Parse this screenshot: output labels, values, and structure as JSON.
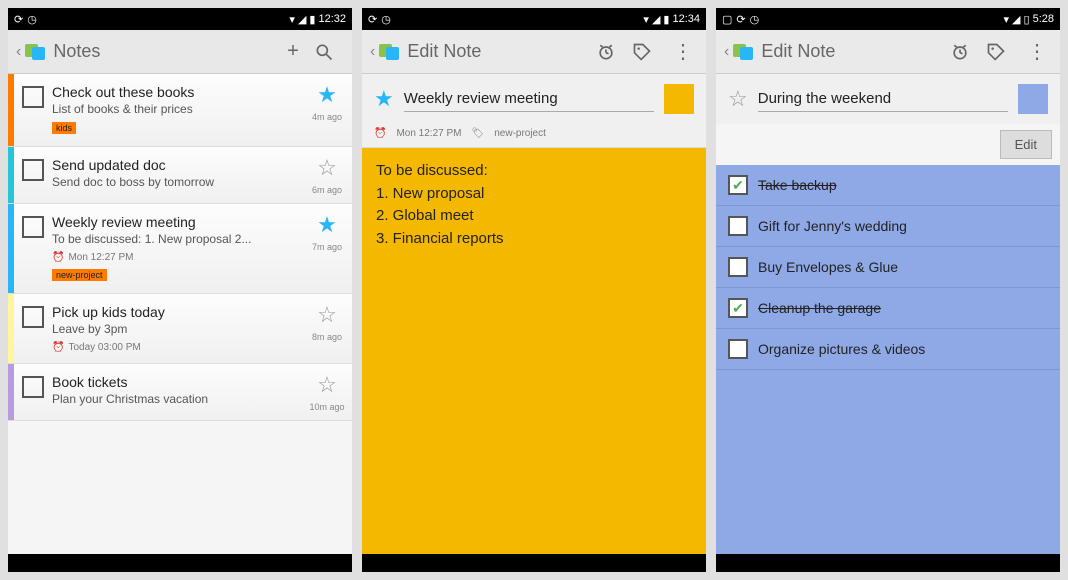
{
  "screen1": {
    "status_time": "12:32",
    "title": "Notes",
    "notes": [
      {
        "stripe": "#ff7b00",
        "title": "Check out these books",
        "sub": "List of books & their prices",
        "tag": "kids",
        "starred": true,
        "ago": "4m ago",
        "reminder": ""
      },
      {
        "stripe": "#26c6da",
        "title": "Send updated doc",
        "sub": "Send doc to boss by tomorrow",
        "tag": "",
        "starred": false,
        "ago": "6m ago",
        "reminder": ""
      },
      {
        "stripe": "#29b6f6",
        "title": "Weekly review meeting",
        "sub": "To be discussed: 1. New proposal 2...",
        "tag": "new-project",
        "starred": true,
        "ago": "7m ago",
        "reminder": "Mon 12:27 PM"
      },
      {
        "stripe": "#fff59d",
        "title": "Pick up kids today",
        "sub": "Leave by 3pm",
        "tag": "",
        "starred": false,
        "ago": "8m ago",
        "reminder": "Today 03:00 PM"
      },
      {
        "stripe": "#b39ddb",
        "title": "Book tickets",
        "sub": "Plan your Christmas vacation",
        "tag": "",
        "starred": false,
        "ago": "10m ago",
        "reminder": ""
      }
    ]
  },
  "screen2": {
    "status_time": "12:34",
    "title": "Edit Note",
    "note_title": "Weekly review meeting",
    "swatch": "#f5b800",
    "reminder": "Mon 12:27 PM",
    "tag": "new-project",
    "body": "To be discussed:\n1. New proposal\n2. Global meet\n3. Financial reports"
  },
  "screen3": {
    "status_time": "5:28",
    "title": "Edit Note",
    "note_title": "During the weekend",
    "swatch": "#8fa8e6",
    "edit_label": "Edit",
    "items": [
      {
        "label": "Take backup",
        "done": true
      },
      {
        "label": "Gift for Jenny's wedding",
        "done": false
      },
      {
        "label": "Buy Envelopes & Glue",
        "done": false
      },
      {
        "label": "Cleanup the garage",
        "done": true
      },
      {
        "label": "Organize pictures & videos",
        "done": false
      }
    ]
  }
}
